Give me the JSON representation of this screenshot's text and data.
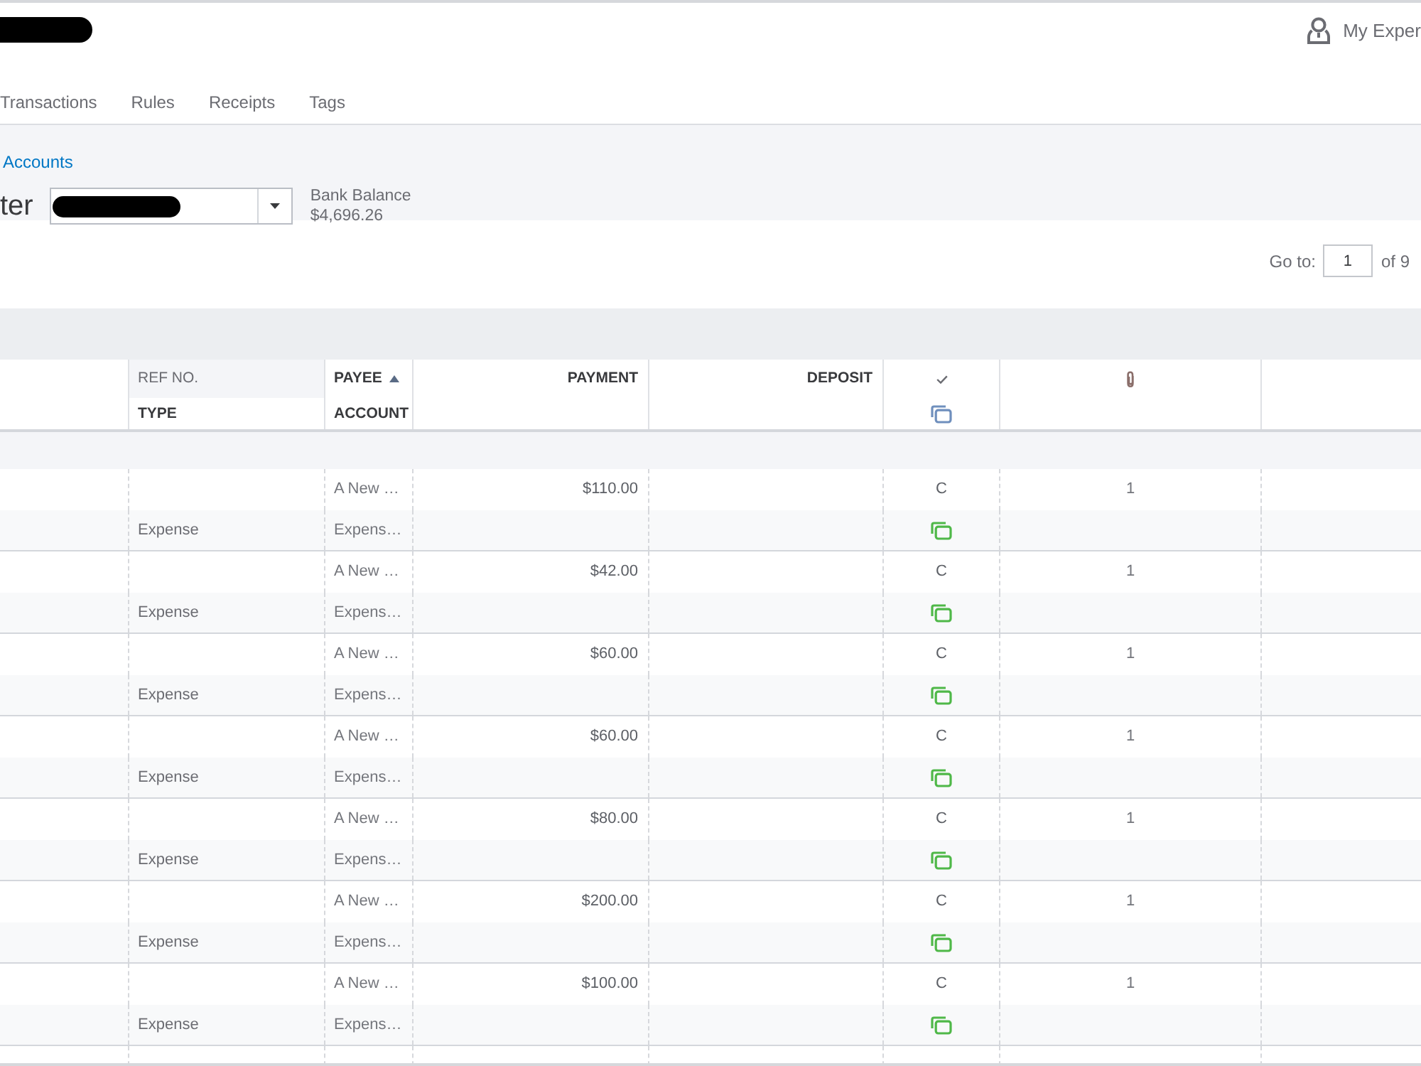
{
  "top_bar": {
    "account_label": "My Exper"
  },
  "tabs": [
    {
      "label": "Transactions",
      "selected": false
    },
    {
      "label": "Rules",
      "selected": false
    },
    {
      "label": "Receipts",
      "selected": false
    },
    {
      "label": "Tags",
      "selected": false
    }
  ],
  "register": {
    "breadcrumb": "Accounts",
    "title": "ter",
    "balance_label": "Bank Balance",
    "balance": "$4,696.26"
  },
  "pagination": {
    "label": "Go to:",
    "page": "1",
    "total": "of 9"
  },
  "table": {
    "columns": [
      {
        "kind": "text",
        "sorted": false,
        "lines": [
          {
            "label": "REF NO.",
            "highlighted": true
          },
          {
            "label": "TYPE",
            "highlighted": false
          }
        ]
      },
      {
        "kind": "text",
        "sorted": true,
        "lines": [
          {
            "label": "PAYEE",
            "highlighted": false
          },
          {
            "label": "ACCOUNT",
            "highlighted": false
          }
        ]
      },
      {
        "kind": "amount",
        "sorted": false,
        "lines": [
          {
            "label": "PAYMENT",
            "highlighted": false
          }
        ]
      },
      {
        "kind": "amount",
        "sorted": false,
        "lines": [
          {
            "label": "DEPOSIT",
            "highlighted": false
          }
        ]
      }
    ],
    "rows": [
      {
        "payee": "A New …",
        "payment": "$110.00",
        "status": "C",
        "attachments": "1",
        "type": "Expense",
        "account": "Expens…"
      },
      {
        "payee": "A New …",
        "payment": "$42.00",
        "status": "C",
        "attachments": "1",
        "type": "Expense",
        "account": "Expens…"
      },
      {
        "payee": "A New …",
        "payment": "$60.00",
        "status": "C",
        "attachments": "1",
        "type": "Expense",
        "account": "Expens…"
      },
      {
        "payee": "A New …",
        "payment": "$60.00",
        "status": "C",
        "attachments": "1",
        "type": "Expense",
        "account": "Expens…"
      },
      {
        "payee": "A New …",
        "payment": "$80.00",
        "status": "C",
        "attachments": "1",
        "type": "Expense",
        "account": "Expens…"
      },
      {
        "payee": "A New …",
        "payment": "$200.00",
        "status": "C",
        "attachments": "1",
        "type": "Expense",
        "account": "Expens…"
      },
      {
        "payee": "A New …",
        "payment": "$100.00",
        "status": "C",
        "attachments": "1",
        "type": "Expense",
        "account": "Expens…"
      }
    ]
  }
}
